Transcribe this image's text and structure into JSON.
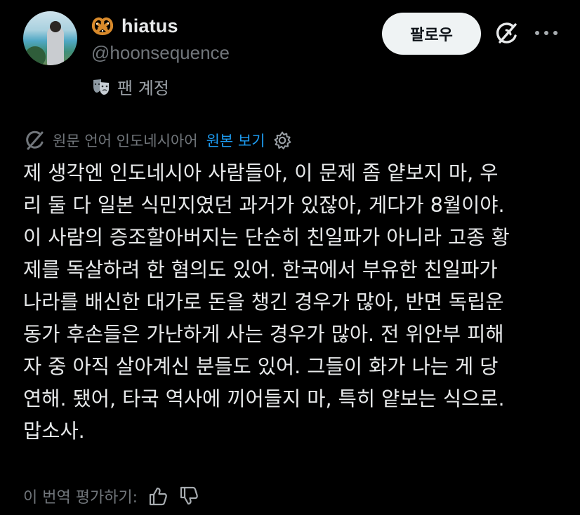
{
  "profile": {
    "display_name": "hiatus",
    "handle": "@hoonsequence",
    "fan_label": "팬 계정",
    "name_emoji": "pretzel-icon",
    "fan_emoji": "performing-arts-icon"
  },
  "actions": {
    "follow_label": "팔로우",
    "grok_icon": "grok-icon",
    "more_icon": "more-icon"
  },
  "translation": {
    "original_language": "원문 언어 인도네시아어",
    "show_original": "원본 보기"
  },
  "post": {
    "lines": [
      "제 생각엔 인도네시아 사람들아, 이 문제 좀 얕보지 마, 우",
      "리 둘 다 일본 식민지였던 과거가 있잖아, 게다가 8월이야.",
      "이 사람의 증조할아버지는 단순히 친일파가 아니라 고종 황",
      "제를 독살하려 한 혐의도 있어. 한국에서 부유한 친일파가",
      "나라를 배신한 대가로 돈을 챙긴 경우가 많아, 반면 독립운",
      "동가 후손들은 가난하게 사는 경우가 많아. 전 위안부 피해",
      "자 중 아직 살아계신 분들도 있어. 그들이 화가 나는 게 당",
      "연해. 됐어, 타국 역사에 끼어들지 마, 특히 얕보는 식으로.",
      "맙소사."
    ]
  },
  "rating": {
    "label": "이 번역 평가하기:"
  },
  "colors": {
    "background": "#000000",
    "text_primary": "#e7e9ea",
    "text_secondary": "#71767b",
    "link": "#1d9bf0",
    "follow_button_bg": "#eff3f4"
  }
}
